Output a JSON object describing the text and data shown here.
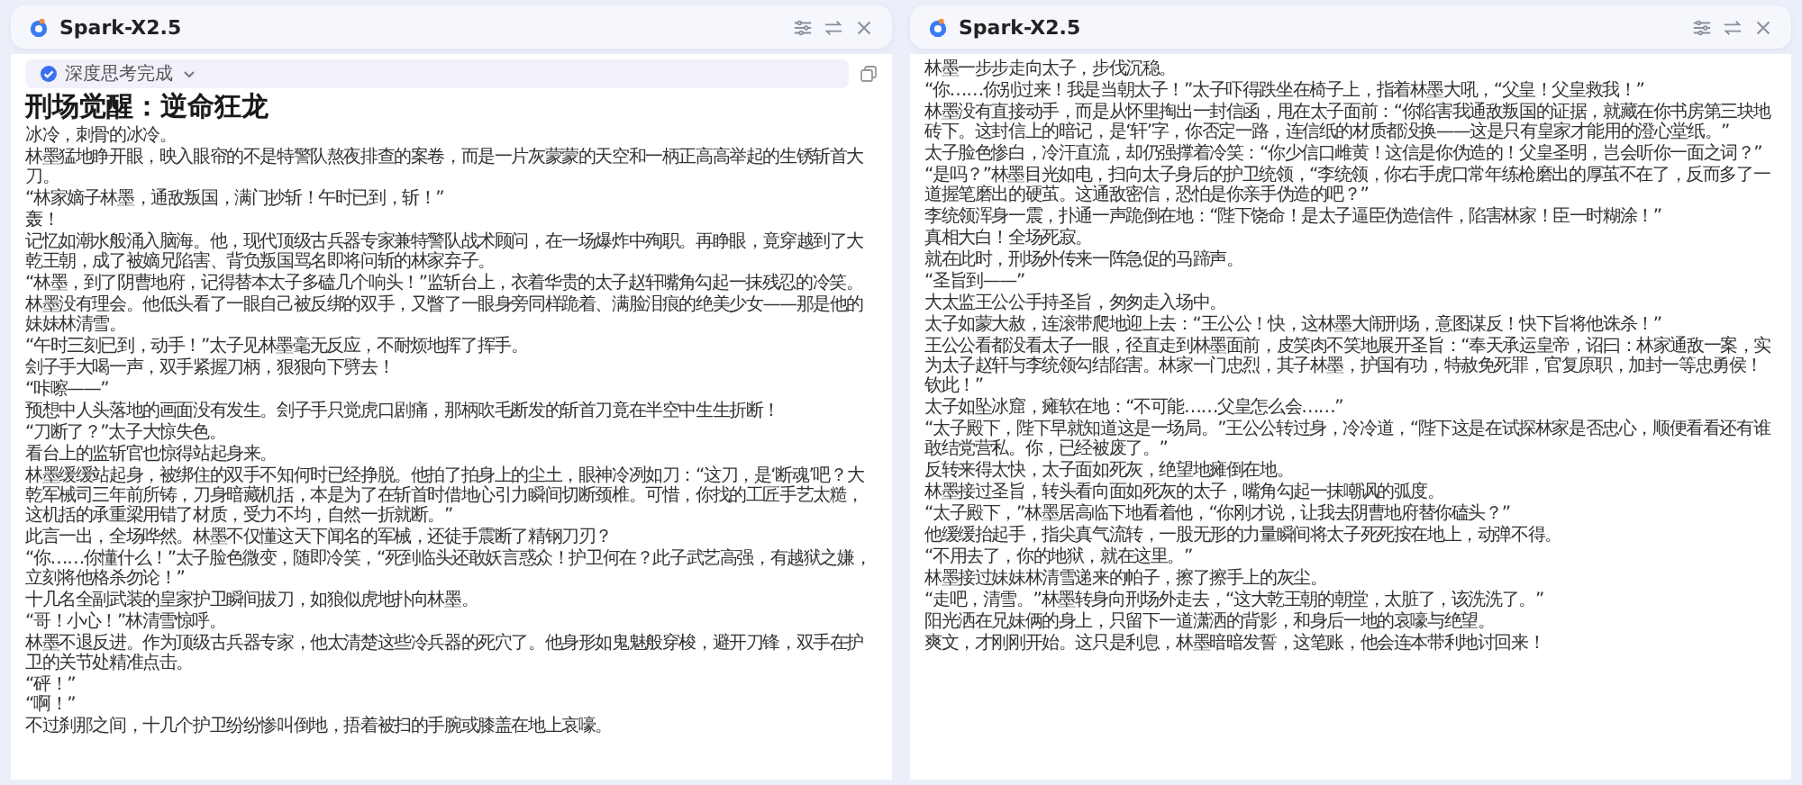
{
  "panels": [
    {
      "title": "Spark-X2.5",
      "thinking_label": "深度思考完成",
      "heading": "刑场觉醒：逆命狂龙",
      "paragraphs": [
        [
          "冰冷，刺骨的冰冷。"
        ],
        [
          "林墨猛地睁开眼，映入眼帘的不是特警队熬夜排查的案卷，而是一片灰蒙蒙的天空和一柄正高高举起的生锈斩首大刀。"
        ],
        [
          "“林家嫡子林墨，通敌叛国，满门抄斩！午时已到，斩！”"
        ],
        [
          "轰！"
        ],
        [
          "记忆如潮水般涌入脑海。他，现代顶级古兵器专家兼特警队战术顾问，在一场爆炸中殉职。再睁眼，竟穿越到了大乾王朝，成了被嫡兄陷害、背负叛国骂名即将问斩的林家弃子。"
        ],
        [
          "“林墨，到了阴曹地府，记得替本太子多磕几个响头！”监斩台上，衣着华贵的太子赵轩嘴角勾起一抹残忍的冷笑。"
        ],
        [
          "林墨没有理会。他低头看了一眼自己被反绑的双手，又瞥了一眼身旁同样跪着、满脸泪痕的绝美少女——那是他的妹妹林清雪。"
        ],
        [
          "“午时三刻已到，动手！”太子见林墨毫无反应，不耐烦地挥了挥手。"
        ],
        [
          "刽子手大喝一声，双手紧握刀柄，狠狠向下劈去！"
        ],
        [
          "“咔嚓——”"
        ],
        [
          "预想中人头落地的画面没有发生。刽子手只觉虎口剧痛，那柄吹毛断发的斩首刀竟在半空中生生折断！"
        ],
        [
          "“刀断了？”太子大惊失色。"
        ],
        [
          "看台上的监斩官也惊得站起身来。"
        ],
        [
          "林墨缓缓站起身，被绑住的双手不知何时已经挣脱。他拍了拍身上的尘土，眼神冷冽如刀：“这刀，是‘断魂’吧？大乾军械司三年前所铸，刀身暗藏机括，本是为了在斩首时借地心引力瞬间切断颈椎。可惜，你找的工匠手艺太糙，这机括的承重梁用错了材质，受力不均，自然一折就断。”"
        ],
        [
          "此言一出，全场哗然。林墨不仅懂这天下闻名的军械，还徒手震断了精钢刀刃？"
        ],
        [
          "“你……你懂什么！”太子脸色微变，随即冷笑，“死到临头还敢妖言惑众！护卫何在？此子武艺高强，有越狱之嫌，立刻将他格杀勿论！”"
        ],
        [
          "十几名全副武装的皇家护卫瞬间拔刀，如狼似虎地扑向林墨。"
        ],
        [
          "“哥！小心！”林清雪惊呼。"
        ],
        [
          "林墨不退反进。作为顶级古兵器专家，他太清楚这些冷兵器的死穴了。他身形如鬼魅般穿梭，避开刀锋，双手在护卫的关节处精准点击。"
        ],
        [
          "“砰！”",
          "“啊！”"
        ],
        [
          "不过刹那之间，十几个护卫纷纷惨叫倒地，捂着被扫的手腕或膝盖在地上哀嚎。"
        ]
      ]
    },
    {
      "title": "Spark-X2.5",
      "paragraphs": [
        [
          "林墨一步步走向太子，步伐沉稳。"
        ],
        [
          "“你……你别过来！我是当朝太子！”太子吓得跌坐在椅子上，指着林墨大吼，“父皇！父皇救我！”"
        ],
        [
          "林墨没有直接动手，而是从怀里掏出一封信函，甩在太子面前：“你陷害我通敌叛国的证据，就藏在你书房第三块地砖下。这封信上的暗记，是‘轩’字，你否定一路，连信纸的材质都没换——这是只有皇家才能用的澄心堂纸。”"
        ],
        [
          "太子脸色惨白，冷汗直流，却仍强撑着冷笑：“你少信口雌黄！这信是你伪造的！父皇圣明，岂会听你一面之词？”"
        ],
        [
          "“是吗？”林墨目光如电，扫向太子身后的护卫统领，“李统领，你右手虎口常年练枪磨出的厚茧不在了，反而多了一道握笔磨出的硬茧。这通敌密信，恐怕是你亲手伪造的吧？”"
        ],
        [
          "李统领浑身一震，扑通一声跪倒在地：“陛下饶命！是太子逼臣伪造信件，陷害林家！臣一时糊涂！”"
        ],
        [
          "真相大白！全场死寂。"
        ],
        [
          "就在此时，刑场外传来一阵急促的马蹄声。"
        ],
        [
          "“圣旨到——”"
        ],
        [
          "大太监王公公手持圣旨，匆匆走入场中。"
        ],
        [
          "太子如蒙大赦，连滚带爬地迎上去：“王公公！快，这林墨大闹刑场，意图谋反！快下旨将他诛杀！”"
        ],
        [
          "王公公看都没看太子一眼，径直走到林墨面前，皮笑肉不笑地展开圣旨：“奉天承运皇帝，诏曰：林家通敌一案，实为太子赵轩与李统领勾结陷害。林家一门忠烈，其子林墨，护国有功，特赦免死罪，官复原职，加封一等忠勇侯！钦此！”"
        ],
        [
          "太子如坠冰窟，瘫软在地：“不可能……父皇怎么会……”"
        ],
        [
          "“太子殿下，陛下早就知道这是一场局。”王公公转过身，冷冷道，“陛下这是在试探林家是否忠心，顺便看看还有谁敢结党营私。你，已经被废了。”"
        ],
        [
          "反转来得太快，太子面如死灰，绝望地瘫倒在地。"
        ],
        [
          "林墨接过圣旨，转头看向面如死灰的太子，嘴角勾起一抹嘲讽的弧度。"
        ],
        [
          "“太子殿下，”林墨居高临下地看着他，“你刚才说，让我去阴曹地府替你磕头？”"
        ],
        [
          "他缓缓抬起手，指尖真气流转，一股无形的力量瞬间将太子死死按在地上，动弹不得。"
        ],
        [
          "“不用去了，你的地狱，就在这里。”"
        ],
        [
          "林墨接过妹妹林清雪递来的帕子，擦了擦手上的灰尘。"
        ],
        [
          "“走吧，清雪。”林墨转身向刑场外走去，“这大乾王朝的朝堂，太脏了，该洗洗了。”"
        ],
        [
          "阳光洒在兄妹俩的身上，只留下一道潇洒的背影，和身后一地的哀嚎与绝望。"
        ],
        [
          "爽文，才刚刚开始。这只是利息，林墨暗暗发誓，这笔账，他会连本带利地讨回来！"
        ]
      ]
    }
  ]
}
